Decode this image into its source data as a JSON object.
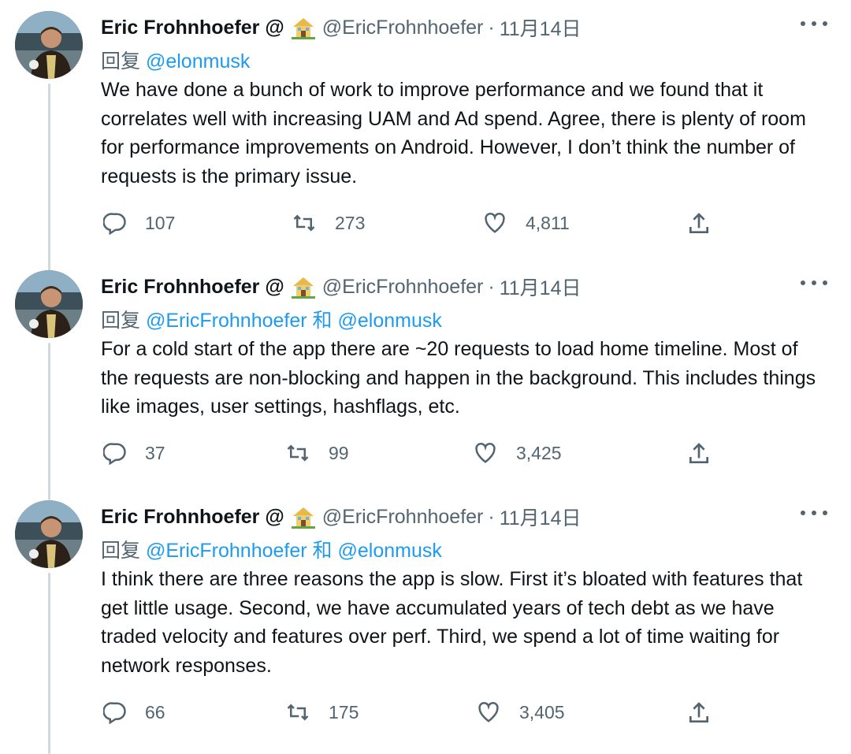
{
  "tweets": [
    {
      "name": "Eric Frohnhoefer @",
      "handle": "@EricFrohnhoefer",
      "dot": "·",
      "date": "11月14日",
      "reply_prefix": "回复",
      "reply_mentions": "@elonmusk",
      "text": "We have done a bunch of work to improve performance and we found that it correlates well with increasing UAM and Ad spend. Agree, there is plenty of room for performance improvements on Android. However, I don’t think the number of requests is the primary issue.",
      "replies": "107",
      "retweets": "273",
      "likes": "4,811"
    },
    {
      "name": "Eric Frohnhoefer @",
      "handle": "@EricFrohnhoefer",
      "dot": "·",
      "date": "11月14日",
      "reply_prefix": "回复",
      "reply_mentions": "@EricFrohnhoefer 和 @elonmusk",
      "text": "For a cold start of the app there are ~20 requests to load home timeline. Most of the requests are non-blocking and happen in the background. This includes things like images, user settings, hashflags, etc.",
      "replies": "37",
      "retweets": "99",
      "likes": "3,425"
    },
    {
      "name": "Eric Frohnhoefer @",
      "handle": "@EricFrohnhoefer",
      "dot": "·",
      "date": "11月14日",
      "reply_prefix": "回复",
      "reply_mentions": "@EricFrohnhoefer 和 @elonmusk",
      "text": "I think there are three reasons the app is slow. First it’s bloated with features that get little usage. Second, we have accumulated years of tech debt as we have traded velocity and features over perf. Third, we spend a lot of time waiting for network responses.",
      "replies": "66",
      "retweets": "175",
      "likes": "3,405"
    }
  ],
  "icons": {
    "reply": "reply-icon",
    "retweet": "retweet-icon",
    "like": "heart-icon",
    "share": "share-icon",
    "more": "more-icon",
    "house": "house-emoji-icon"
  },
  "colors": {
    "text": "#0f1419",
    "secondary": "#536471",
    "link": "#1d9bf0",
    "thread_line": "#cfd9de"
  }
}
